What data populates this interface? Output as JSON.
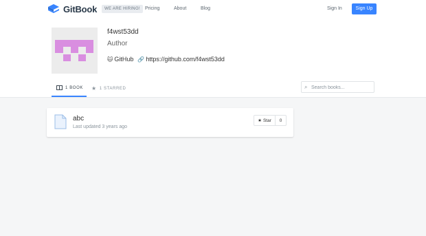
{
  "brand": {
    "name": "GitBook"
  },
  "header": {
    "hiring_label": "WE ARE HIRING!",
    "nav": [
      {
        "label": "Pricing"
      },
      {
        "label": "About"
      },
      {
        "label": "Blog"
      }
    ],
    "signin_label": "Sign In",
    "signup_label": "Sign Up"
  },
  "profile": {
    "username": "f4wst53dd",
    "role": "Author",
    "github_label": "GitHub",
    "website": "https://github.com/f4wst53dd"
  },
  "tabs": [
    {
      "label": "1 BOOK",
      "icon": "book-icon",
      "active": true
    },
    {
      "label": "1 STARRED",
      "icon": "star-icon",
      "active": false
    }
  ],
  "search": {
    "placeholder": "Search books..."
  },
  "books": [
    {
      "title": "abc",
      "updated": "Last updated 3 years ago",
      "star_label": "Star",
      "star_count": "0"
    }
  ],
  "colors": {
    "accent": "#3884ff",
    "avatar": "#d98ee0"
  }
}
